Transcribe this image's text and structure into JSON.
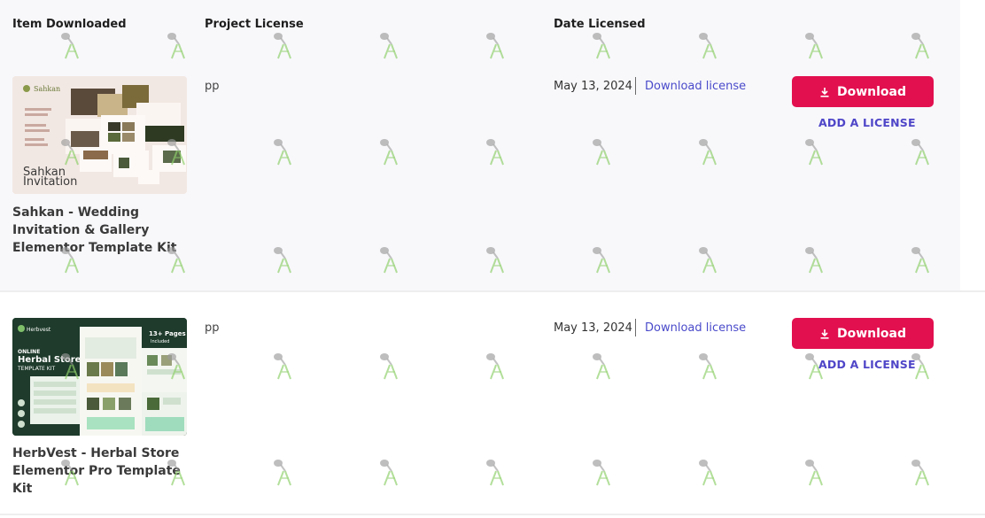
{
  "table": {
    "headers": {
      "item": "Item Downloaded",
      "project": "Project License",
      "date": "Date Licensed"
    },
    "rows": [
      {
        "thumbnail": {
          "brand": "Sahkan",
          "caption_line1": "Sahkan",
          "caption_line2": "Invitation"
        },
        "title": "Sahkan - Wedding Invitation & Gallery Elementor Template Kit",
        "project": "pp",
        "date": "May 13, 2024",
        "download_license_label": "Download license",
        "download_button_label": "Download",
        "add_license_label": "ADD A LICENSE"
      },
      {
        "thumbnail": {
          "brand": "Herbvest",
          "headline_small": "ONLINE",
          "headline_big": "Herbal Store",
          "headline_kit": "TEMPLATE KIT",
          "pages_badge": "13+ Pages",
          "pages_badge_sub": "Included"
        },
        "title": "HerbVest - Herbal Store Elementor Pro Template Kit",
        "project": "pp",
        "date": "May 13, 2024",
        "download_license_label": "Download license",
        "download_button_label": "Download",
        "add_license_label": "ADD A LICENSE"
      }
    ]
  },
  "colors": {
    "download_button": "#e2104f",
    "link": "#4a4acb",
    "row_shade": "#f8f8fb"
  },
  "icons": {
    "download_button_icon": "download-icon",
    "watermark": "watermark-icon"
  }
}
